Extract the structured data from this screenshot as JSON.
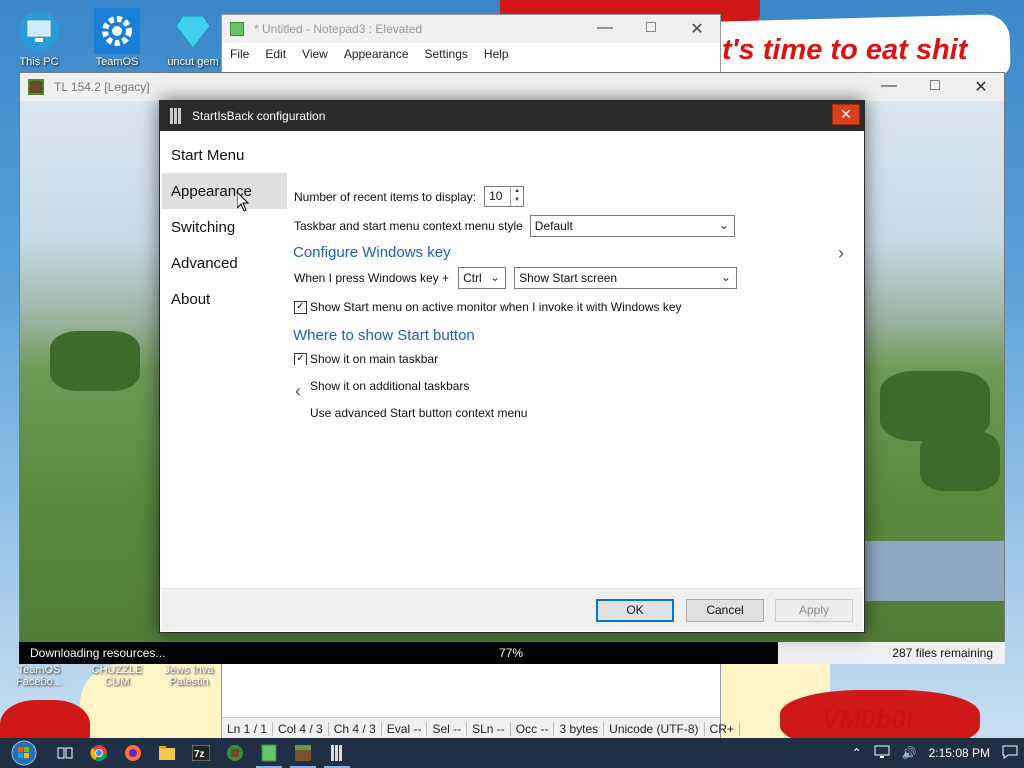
{
  "desktop": {
    "banner_text": "t's time to eat shit",
    "corner_text": "VM0b0t",
    "icons": [
      {
        "label": "This PC"
      },
      {
        "label": "TeamOS"
      },
      {
        "label": "uncut gem"
      },
      {
        "label": "TeamOS Facebo..."
      },
      {
        "label": "CHUZZLE CUM"
      },
      {
        "label": "Jews Inva Palestin"
      }
    ]
  },
  "notepad": {
    "title": "* Untitled - Notepad3 : Elevated",
    "menu": [
      "File",
      "Edit",
      "View",
      "Appearance",
      "Settings",
      "Help"
    ],
    "status": [
      "Ln 1 / 1",
      "Col 4 / 3",
      "Ch 4 / 3",
      "Eval --",
      "Sel --",
      "SLn --",
      "Occ --",
      "3 bytes",
      "Unicode (UTF-8)",
      "CR+"
    ]
  },
  "launcher": {
    "title": "TL 154.2 [Legacy]",
    "progress_left": "Downloading resources...",
    "progress_pct": "77%",
    "progress_value": 0.77,
    "progress_right": "287 files remaining"
  },
  "dialog": {
    "title": "StartIsBack configuration",
    "close": "✕",
    "nav": [
      {
        "label": "Start Menu"
      },
      {
        "label": "Appearance"
      },
      {
        "label": "Switching"
      },
      {
        "label": "Advanced"
      },
      {
        "label": "About"
      }
    ],
    "recent_items_label": "Number of recent items to display:",
    "recent_items_value": "10",
    "context_style_label": "Taskbar and start menu context menu style",
    "context_style_value": "Default",
    "win_key_heading": "Configure Windows key",
    "win_key_label": "When I press Windows key +",
    "win_key_modifier": "Ctrl",
    "win_key_action": "Show Start screen",
    "active_monitor_label": "Show Start menu on active monitor when I invoke it with Windows key",
    "start_button_heading": "Where to show Start button",
    "main_taskbar_label": "Show it on main taskbar",
    "additional_taskbars_label": "Show it on additional taskbars",
    "advanced_menu_label": "Use advanced Start button context menu",
    "ok": "OK",
    "cancel": "Cancel",
    "apply": "Apply"
  },
  "taskbar": {
    "time": "2:15:08 PM"
  },
  "colors": {
    "heading_blue": "#1f5fbf",
    "close_red": "#d9411e",
    "ok_border": "#0078d7"
  }
}
